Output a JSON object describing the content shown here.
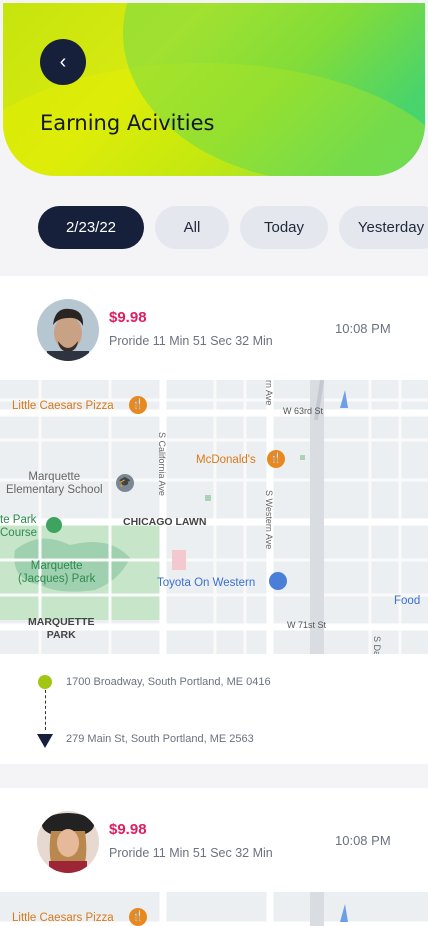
{
  "header": {
    "title": "Earning Acivities",
    "back_icon": "chevron-left-icon"
  },
  "filters": [
    {
      "label": "2/23/22",
      "active": true
    },
    {
      "label": "All",
      "active": false
    },
    {
      "label": "Today",
      "active": false
    },
    {
      "label": "Yesterday",
      "active": false
    }
  ],
  "rides": [
    {
      "price": "$9.98",
      "duration": "Proride 11 Min 51 Sec 32 Min",
      "time": "10:08 PM",
      "pickup": "1700 Broadway, South Portland, ME 0416",
      "dropoff": "279 Main St, South Portland, ME 2563"
    },
    {
      "price": "$9.98",
      "duration": "Proride 11 Min 51 Sec 32 Min",
      "time": "10:08 PM"
    }
  ],
  "map": {
    "labels": {
      "little_caesars": "Little Caesars Pizza",
      "w63": "W 63rd St",
      "mcdonalds": "McDonald's",
      "marquette_school": "Marquette\nElementary School",
      "chicago_lawn": "CHICAGO LAWN",
      "te_park": "te Park\nCourse",
      "marquette_park_inner": "Marquette\n(Jacques) Park",
      "toyota": "Toyota On Western",
      "food": "Food",
      "w71": "W 71st St",
      "marquette_park": "MARQUETTE\nPARK",
      "s_california": "S California Ave",
      "s_western": "S Western Ave",
      "s_damen": "S Da",
      "n_ave": "rn Ave"
    },
    "colors": {
      "park": "#c7e6c9",
      "road": "#ffffff",
      "poi_orange": "#e8891f",
      "poi_blue": "#4a7fd9",
      "text_orange": "#d9791a",
      "text_blue": "#3b6fd1",
      "label": "#555555"
    }
  }
}
